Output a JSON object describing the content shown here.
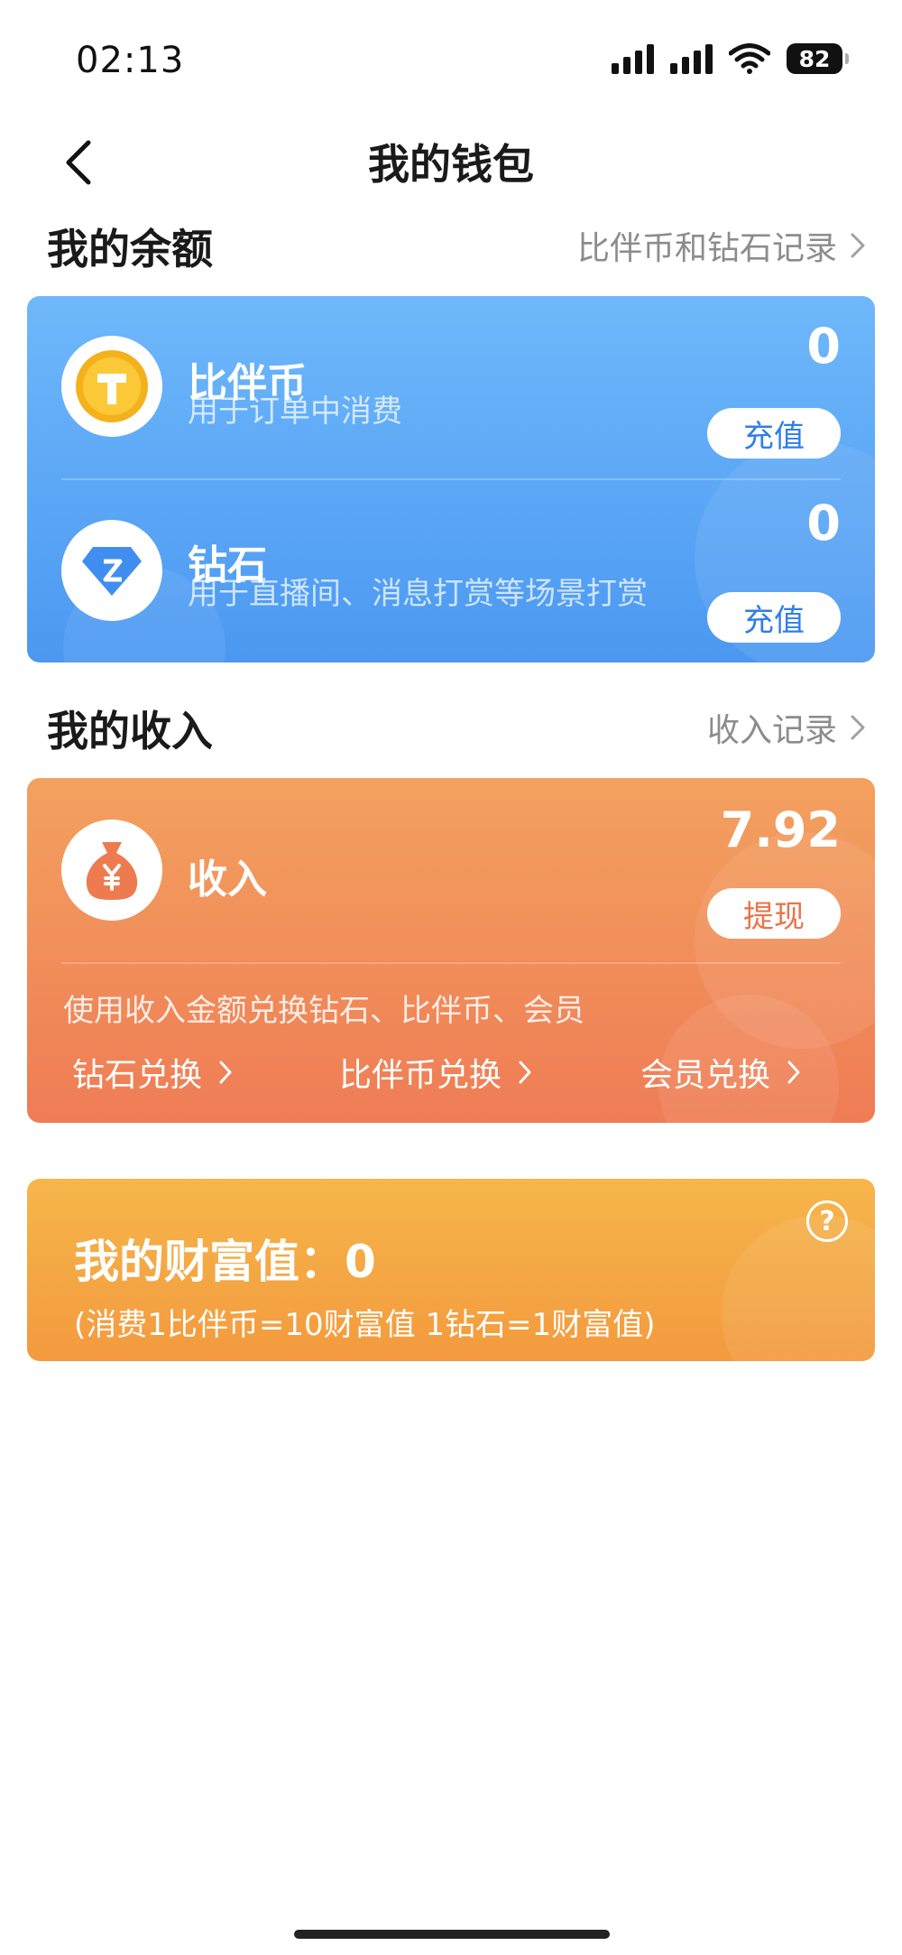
{
  "status_bar": {
    "time": "02:13",
    "battery": "82",
    "icons": [
      "signal-icon",
      "signal-icon",
      "wifi-icon",
      "battery-icon"
    ]
  },
  "nav": {
    "title": "我的钱包",
    "back_icon": "chevron-left-icon"
  },
  "balance": {
    "section_title": "我的余额",
    "records_link": "比伴币和钻石记录",
    "card_color": "#5aa6f6",
    "items": [
      {
        "title": "比伴币",
        "desc": "用于订单中消费",
        "amount": "0",
        "button": "充值",
        "icon": "coin-icon"
      },
      {
        "title": "钻石",
        "desc": "用于直播间、消息打赏等场景打赏",
        "amount": "0",
        "button": "充值",
        "icon": "diamond-icon"
      }
    ]
  },
  "income": {
    "section_title": "我的收入",
    "records_link": "收入记录",
    "card_color": "#f08e5a",
    "title": "收入",
    "amount": "7.92",
    "button": "提现",
    "icon": "money-bag-icon",
    "note": "使用收入金额兑换钻石、比伴币、会员",
    "exchanges": [
      "钻石兑换",
      "比伴币兑换",
      "会员兑换"
    ]
  },
  "wealth": {
    "title": "我的财富值：0",
    "note": "(消费1比伴币=10财富值 1钻石=1财富值)",
    "card_color": "#f4a843",
    "help_icon": "help-icon"
  }
}
